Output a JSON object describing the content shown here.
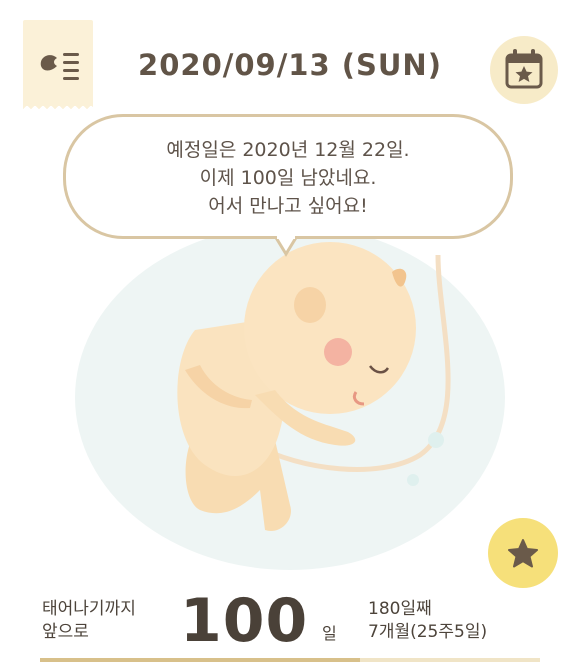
{
  "header": {
    "date": "2020/09/13 (SUN)",
    "menu_icon": "feather-list-icon",
    "calendar_icon": "calendar-star-icon"
  },
  "bubble": {
    "line1": "예정일은 2020년 12월 22일.",
    "line2": "이제 100일 남았네요.",
    "line3": "어서 만나고 싶어요!"
  },
  "illustration": {
    "subject": "baby-in-womb"
  },
  "favorite_icon": "star-icon",
  "countdown": {
    "label_line1": "태어나기까지",
    "label_line2": "앞으로",
    "days": "100",
    "unit": "일",
    "day_count": "180일째",
    "month_week": "7개월(25주5일)",
    "progress_fraction": 0.64
  },
  "colors": {
    "accent": "#d8c08a",
    "menu_bg": "#fbf1d8",
    "star_bg": "#f6e07a",
    "belly": "#eef5f4"
  }
}
